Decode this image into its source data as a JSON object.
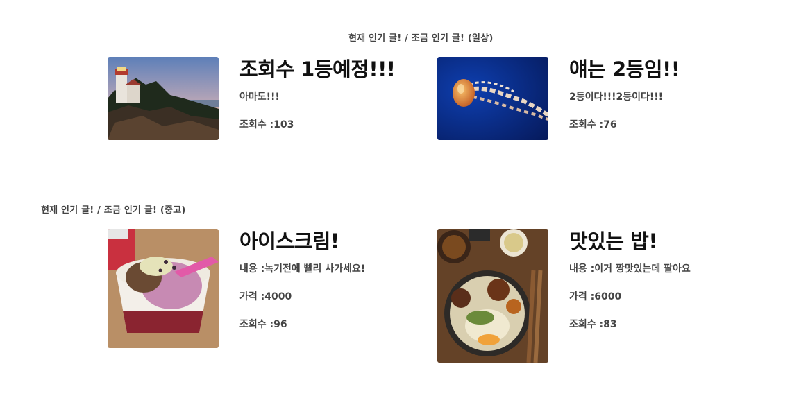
{
  "daily": {
    "heading": "현재 인기 글! / 조금 인기 글! (일상)",
    "posts": [
      {
        "title": "조회수 1등예정!!!",
        "content": "아마도!!!",
        "views_label": "조회수 :",
        "views": "103",
        "image": "lighthouse-photo"
      },
      {
        "title": "얘는 2등임!!",
        "content": "2등이다!!!2등이다!!!",
        "views_label": "조회수 :",
        "views": "76",
        "image": "jellyfish-photo"
      }
    ]
  },
  "used": {
    "heading": "현재 인기 글! / 조금 인기 글! (중고)",
    "posts": [
      {
        "title": "아이스크림!",
        "content_label": "내용 :",
        "content": "녹기전에 빨리 사가세요!",
        "price_label": "가격 :",
        "price": "4000",
        "views_label": "조회수 :",
        "views": "96",
        "image": "ice-cream-photo"
      },
      {
        "title": "맛있는 밥!",
        "content_label": "내용 :",
        "content": "이거 짱맛있는데 팔아요",
        "price_label": "가격 :",
        "price": "6000",
        "views_label": "조회수 :",
        "views": "83",
        "image": "rice-bowl-photo"
      }
    ]
  }
}
